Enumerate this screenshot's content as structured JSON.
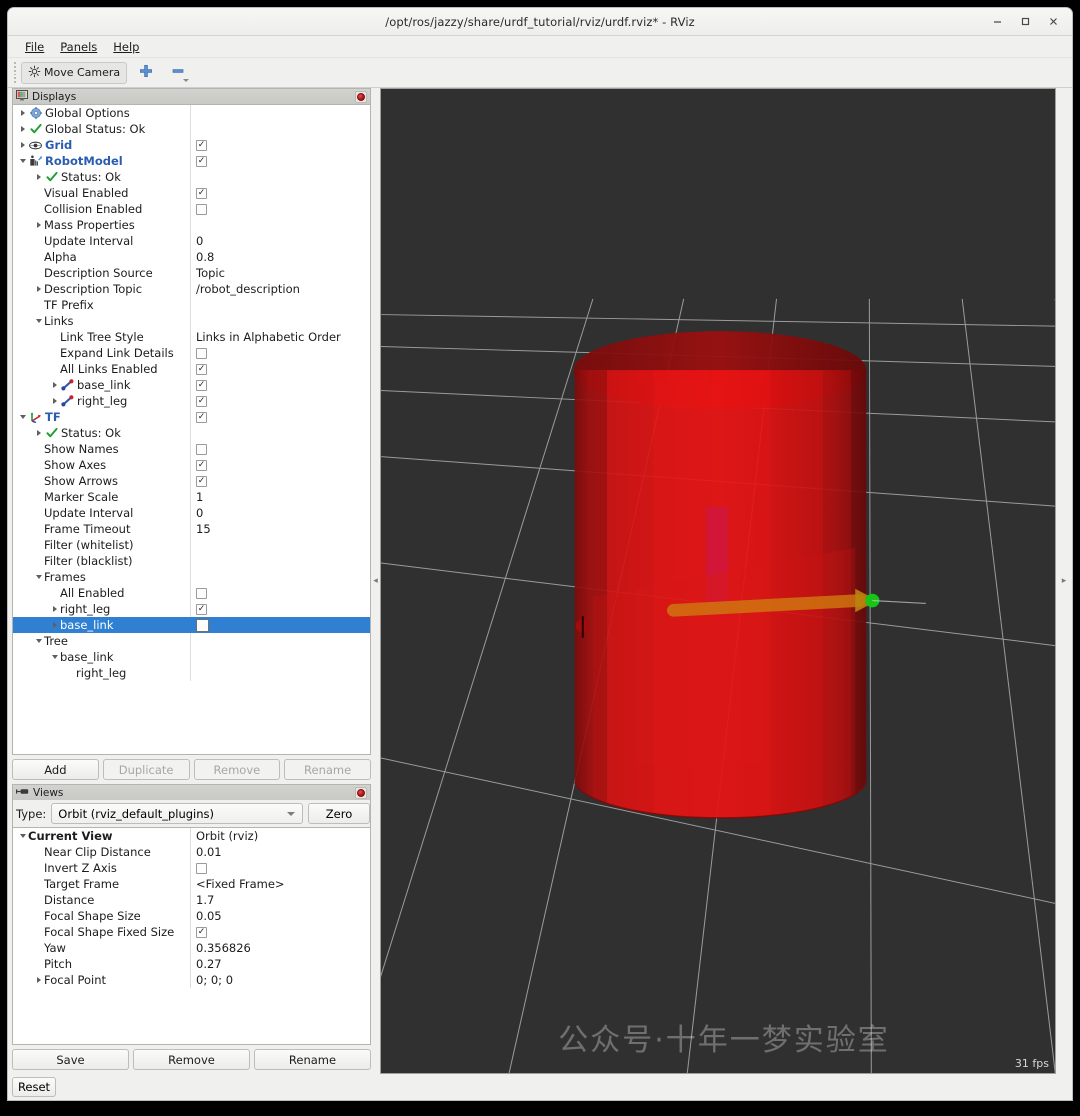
{
  "window": {
    "title": "/opt/ros/jazzy/share/urdf_tutorial/rviz/urdf.rviz* - RViz",
    "minimize_label": "–",
    "maximize_label": "▫",
    "close_label": "✕"
  },
  "menubar": {
    "items": [
      {
        "label": "File",
        "mnemonic": "F"
      },
      {
        "label": "Panels",
        "mnemonic": "P"
      },
      {
        "label": "Help",
        "mnemonic": "H"
      }
    ]
  },
  "toolbar": {
    "move_camera_label": "Move Camera",
    "add_tool_icon": "plus-icon",
    "remove_tool_icon": "minus-icon"
  },
  "displays_panel": {
    "title": "Displays",
    "icon": "displays-monitor-icon",
    "close_icon": "panel-close-icon",
    "rows": [
      {
        "indent": 0,
        "arrow": "right",
        "icon": "gear-icon",
        "label": "Global Options",
        "style": "plain",
        "value": "",
        "control": "none"
      },
      {
        "indent": 0,
        "arrow": "right",
        "icon": "check-icon",
        "label": "Global Status: Ok",
        "style": "plain",
        "value": "",
        "control": "none"
      },
      {
        "indent": 0,
        "arrow": "right",
        "icon": "grid-icon",
        "label": "Grid",
        "style": "bold-blue",
        "value": "",
        "control": "checked"
      },
      {
        "indent": 0,
        "arrow": "down",
        "icon": "robot-icon",
        "label": "RobotModel",
        "style": "bold-blue",
        "value": "",
        "control": "checked"
      },
      {
        "indent": 1,
        "arrow": "right",
        "icon": "check-icon",
        "label": "Status: Ok",
        "style": "plain",
        "value": "",
        "control": "none"
      },
      {
        "indent": 1,
        "arrow": "none",
        "icon": "none",
        "label": "Visual Enabled",
        "style": "plain",
        "value": "",
        "control": "checked"
      },
      {
        "indent": 1,
        "arrow": "none",
        "icon": "none",
        "label": "Collision Enabled",
        "style": "plain",
        "value": "",
        "control": "unchecked"
      },
      {
        "indent": 1,
        "arrow": "right",
        "icon": "none",
        "label": "Mass Properties",
        "style": "plain",
        "value": "",
        "control": "none"
      },
      {
        "indent": 1,
        "arrow": "none",
        "icon": "none",
        "label": "Update Interval",
        "style": "plain",
        "value": "0",
        "control": "none"
      },
      {
        "indent": 1,
        "arrow": "none",
        "icon": "none",
        "label": "Alpha",
        "style": "plain",
        "value": "0.8",
        "control": "none"
      },
      {
        "indent": 1,
        "arrow": "none",
        "icon": "none",
        "label": "Description Source",
        "style": "plain",
        "value": "Topic",
        "control": "none"
      },
      {
        "indent": 1,
        "arrow": "right",
        "icon": "none",
        "label": "Description Topic",
        "style": "plain",
        "value": "/robot_description",
        "control": "none"
      },
      {
        "indent": 1,
        "arrow": "none",
        "icon": "none",
        "label": "TF Prefix",
        "style": "plain",
        "value": "",
        "control": "none"
      },
      {
        "indent": 1,
        "arrow": "down",
        "icon": "none",
        "label": "Links",
        "style": "plain",
        "value": "",
        "control": "none"
      },
      {
        "indent": 2,
        "arrow": "none",
        "icon": "none",
        "label": "Link Tree Style",
        "style": "plain",
        "value": "Links in Alphabetic Order",
        "control": "none"
      },
      {
        "indent": 2,
        "arrow": "none",
        "icon": "none",
        "label": "Expand Link Details",
        "style": "plain",
        "value": "",
        "control": "unchecked"
      },
      {
        "indent": 2,
        "arrow": "none",
        "icon": "none",
        "label": "All Links Enabled",
        "style": "plain",
        "value": "",
        "control": "checked"
      },
      {
        "indent": 2,
        "arrow": "right",
        "icon": "link-icon",
        "label": "base_link",
        "style": "plain",
        "value": "",
        "control": "checked"
      },
      {
        "indent": 2,
        "arrow": "right",
        "icon": "link-icon",
        "label": "right_leg",
        "style": "plain",
        "value": "",
        "control": "checked"
      },
      {
        "indent": 0,
        "arrow": "down",
        "icon": "tf-icon",
        "label": "TF",
        "style": "bold-blue",
        "value": "",
        "control": "checked"
      },
      {
        "indent": 1,
        "arrow": "right",
        "icon": "check-icon",
        "label": "Status: Ok",
        "style": "plain",
        "value": "",
        "control": "none"
      },
      {
        "indent": 1,
        "arrow": "none",
        "icon": "none",
        "label": "Show Names",
        "style": "plain",
        "value": "",
        "control": "unchecked"
      },
      {
        "indent": 1,
        "arrow": "none",
        "icon": "none",
        "label": "Show Axes",
        "style": "plain",
        "value": "",
        "control": "checked"
      },
      {
        "indent": 1,
        "arrow": "none",
        "icon": "none",
        "label": "Show Arrows",
        "style": "plain",
        "value": "",
        "control": "checked"
      },
      {
        "indent": 1,
        "arrow": "none",
        "icon": "none",
        "label": "Marker Scale",
        "style": "plain",
        "value": "1",
        "control": "none"
      },
      {
        "indent": 1,
        "arrow": "none",
        "icon": "none",
        "label": "Update Interval",
        "style": "plain",
        "value": "0",
        "control": "none"
      },
      {
        "indent": 1,
        "arrow": "none",
        "icon": "none",
        "label": "Frame Timeout",
        "style": "plain",
        "value": "15",
        "control": "none"
      },
      {
        "indent": 1,
        "arrow": "none",
        "icon": "none",
        "label": "Filter (whitelist)",
        "style": "plain",
        "value": "",
        "control": "none"
      },
      {
        "indent": 1,
        "arrow": "none",
        "icon": "none",
        "label": "Filter (blacklist)",
        "style": "plain",
        "value": "",
        "control": "none"
      },
      {
        "indent": 1,
        "arrow": "down",
        "icon": "none",
        "label": "Frames",
        "style": "plain",
        "value": "",
        "control": "none"
      },
      {
        "indent": 2,
        "arrow": "none",
        "icon": "none",
        "label": "All Enabled",
        "style": "plain",
        "value": "",
        "control": "unchecked"
      },
      {
        "indent": 2,
        "arrow": "right",
        "icon": "none",
        "label": "right_leg",
        "style": "plain",
        "value": "",
        "control": "checked"
      },
      {
        "indent": 2,
        "arrow": "right",
        "icon": "none",
        "label": "base_link",
        "style": "plain",
        "value": "",
        "control": "unchecked-big",
        "selected": true
      },
      {
        "indent": 1,
        "arrow": "down",
        "icon": "none",
        "label": "Tree",
        "style": "plain",
        "value": "",
        "control": "none"
      },
      {
        "indent": 2,
        "arrow": "down",
        "icon": "none",
        "label": "base_link",
        "style": "plain",
        "value": "",
        "control": "none"
      },
      {
        "indent": 3,
        "arrow": "none",
        "icon": "none",
        "label": "right_leg",
        "style": "plain",
        "value": "",
        "control": "none"
      }
    ],
    "buttons": [
      {
        "label": "Add",
        "enabled": true
      },
      {
        "label": "Duplicate",
        "enabled": false
      },
      {
        "label": "Remove",
        "enabled": false
      },
      {
        "label": "Rename",
        "enabled": false
      }
    ]
  },
  "views_panel": {
    "title": "Views",
    "icon": "views-icon",
    "close_icon": "panel-close-icon",
    "type_label": "Type:",
    "type_value": "Orbit (rviz_default_plugins)",
    "zero_label": "Zero",
    "rows": [
      {
        "indent": 0,
        "arrow": "down",
        "label": "Current View",
        "style": "bold",
        "value": "Orbit (rviz)",
        "value_style": "bold",
        "control": "none"
      },
      {
        "indent": 1,
        "arrow": "none",
        "label": "Near Clip Distance",
        "style": "plain",
        "value": "0.01",
        "control": "none"
      },
      {
        "indent": 1,
        "arrow": "none",
        "label": "Invert Z Axis",
        "style": "plain",
        "value": "",
        "control": "unchecked"
      },
      {
        "indent": 1,
        "arrow": "none",
        "label": "Target Frame",
        "style": "plain",
        "value": "<Fixed Frame>",
        "control": "none"
      },
      {
        "indent": 1,
        "arrow": "none",
        "label": "Distance",
        "style": "plain",
        "value": "1.7",
        "control": "none"
      },
      {
        "indent": 1,
        "arrow": "none",
        "label": "Focal Shape Size",
        "style": "plain",
        "value": "0.05",
        "control": "none"
      },
      {
        "indent": 1,
        "arrow": "none",
        "label": "Focal Shape Fixed Size",
        "style": "plain",
        "value": "",
        "control": "checked"
      },
      {
        "indent": 1,
        "arrow": "none",
        "label": "Yaw",
        "style": "plain",
        "value": "0.356826",
        "control": "none"
      },
      {
        "indent": 1,
        "arrow": "none",
        "label": "Pitch",
        "style": "plain",
        "value": "0.27",
        "control": "none"
      },
      {
        "indent": 1,
        "arrow": "right",
        "label": "Focal Point",
        "style": "plain",
        "value": "0; 0; 0",
        "control": "none"
      }
    ],
    "buttons": [
      {
        "label": "Save",
        "enabled": true
      },
      {
        "label": "Remove",
        "enabled": true
      },
      {
        "label": "Rename",
        "enabled": true
      }
    ]
  },
  "statusbar": {
    "reset_label": "Reset"
  },
  "viewport": {
    "fps_text": "31 fps",
    "watermark_text": "公众号·十年一梦实验室",
    "watermark_icon": "wechat-icon",
    "cursor_icon": "move-camera-cursor",
    "background_color": "#303030",
    "grid_color": "#b9b9b9",
    "model_color": "#e01010",
    "axis_x_color": "#ff0000",
    "axis_y_color": "#00c000",
    "arrow_color": "#d07a10"
  },
  "splitters": {
    "left_handle": "◂",
    "right_handle": "▸"
  }
}
